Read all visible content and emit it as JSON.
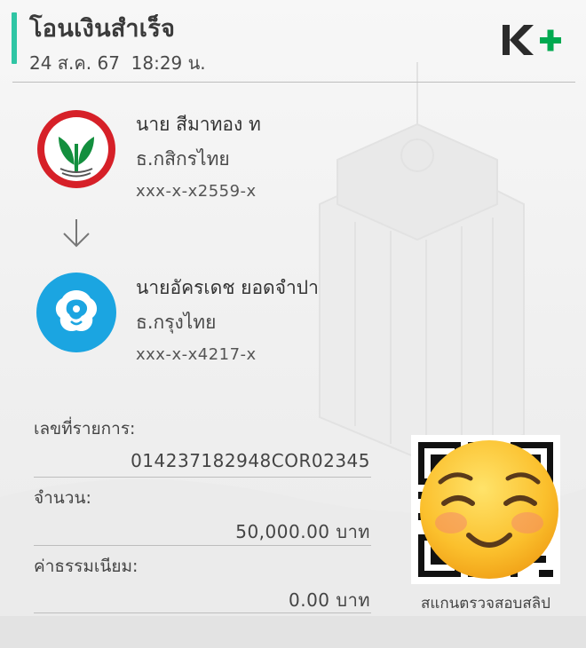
{
  "header": {
    "title": "โอนเงินสำเร็จ",
    "datetime": "24 ส.ค. 67  18:29 น.",
    "brand_logo": "K+",
    "accent_color": "#2fc5a4",
    "brand_color": "#00a950"
  },
  "sender": {
    "name": "นาย สีมาทอง ท",
    "bank": "ธ.กสิกรไทย",
    "account": "xxx-x-x2559-x",
    "logo_icon": "kasikorn-bank-icon"
  },
  "transfer_icon": "arrow-down-icon",
  "receiver": {
    "name": "นายอัครเดช ยอดจำปา",
    "bank": "ธ.กรุงไทย",
    "account": "xxx-x-x4217-x",
    "logo_icon": "krungthai-bank-icon"
  },
  "details": {
    "reference_label": "เลขที่รายการ:",
    "reference_value": "014237182948COR02345",
    "amount_label": "จำนวน:",
    "amount_value": "50,000.00 บาท",
    "fee_label": "ค่าธรรมเนียม:",
    "fee_value": "0.00 บาท"
  },
  "qr": {
    "caption": "สแกนตรวจสอบสลิป",
    "overlay": "smiling-face-emoji"
  }
}
